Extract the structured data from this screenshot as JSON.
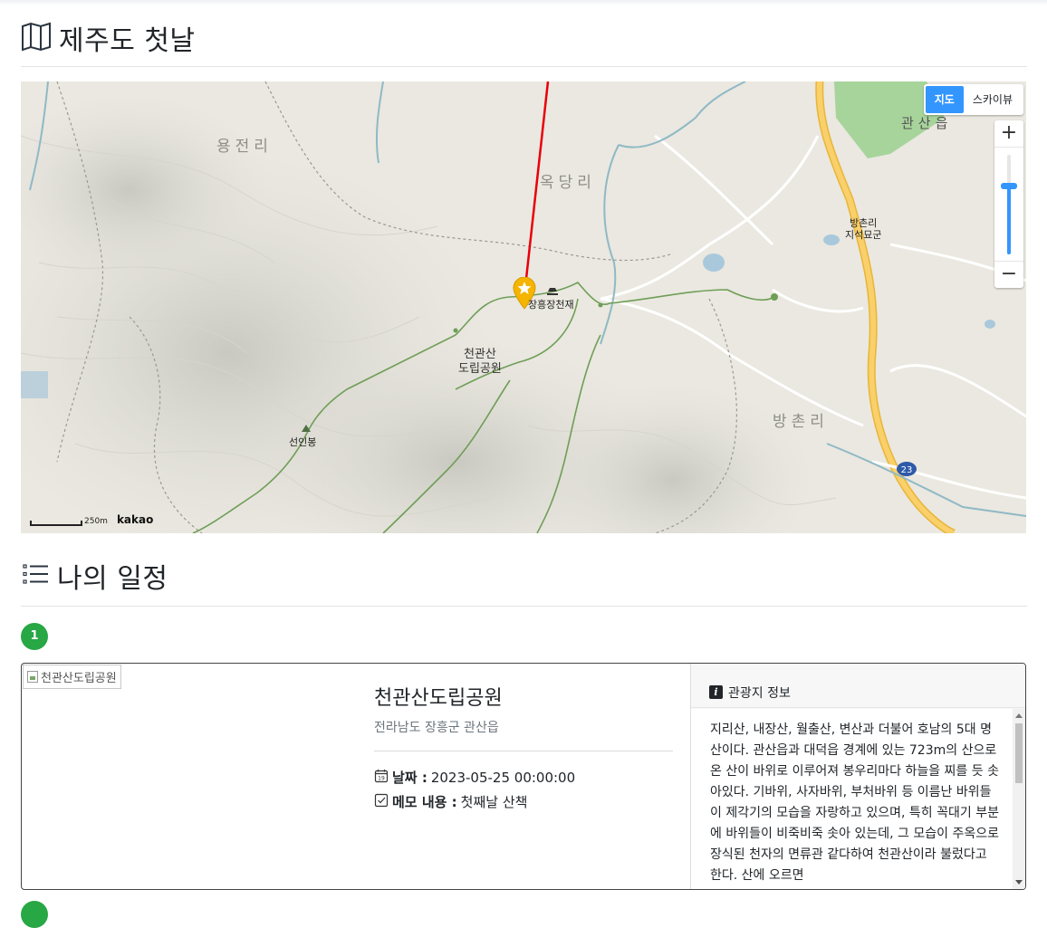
{
  "header": {
    "title": "제주도 첫날",
    "icon": "map-icon"
  },
  "map": {
    "type_control": {
      "map_label": "지도",
      "skyview_label": "스카이뷰",
      "active": "지도"
    },
    "zoom": {
      "in": "+",
      "out": "−"
    },
    "scale": {
      "value": "250m",
      "logo": "kakao"
    },
    "labels": {
      "yongjeonri": "용전리",
      "okdangri": "옥당리",
      "gwansaneup": "관산읍",
      "bangchonri": "방촌리",
      "bangchon_dolmen": "방촌리\n지석묘군",
      "jangheung": "장흥장천재",
      "park": "천관산\n도립공원",
      "seoninbong": "선인봉",
      "route": "23"
    },
    "colors": {
      "route_line": "#e8000b",
      "marker": "#f5b400",
      "trail": "#6f9e57",
      "highway": "#f7c847"
    }
  },
  "schedule": {
    "title": "나의 일정",
    "icon": "list-icon",
    "items": [
      {
        "order": "1",
        "image_alt": "천관산도립공원",
        "name": "천관산도립공원",
        "address": "전라남도 장흥군 관산읍",
        "date_label": "날짜 :",
        "date_value": "2023-05-25 00:00:00",
        "memo_label": "메모 내용 :",
        "memo_value": "첫째날 산책",
        "info_title": "관광지 정보",
        "description": "지리산, 내장산, 월출산, 변산과 더불어 호남의 5대 명산이다. 관산읍과 대덕읍 경계에 있는 723m의 산으로 온 산이 바위로 이루어져 봉우리마다 하늘을 찌를 듯 솟아있다. 기바위, 사자바위, 부처바위 등 이름난 바위들이 제각기의 모습을 자랑하고 있으며, 특히 꼭대기 부분에 바위들이 비죽비죽 솟아 있는데, 그 모습이 주옥으로 장식된 천자의 면류관 같다하여 천관산이라 불렀다고 한다. 산에 오르면"
      }
    ]
  }
}
